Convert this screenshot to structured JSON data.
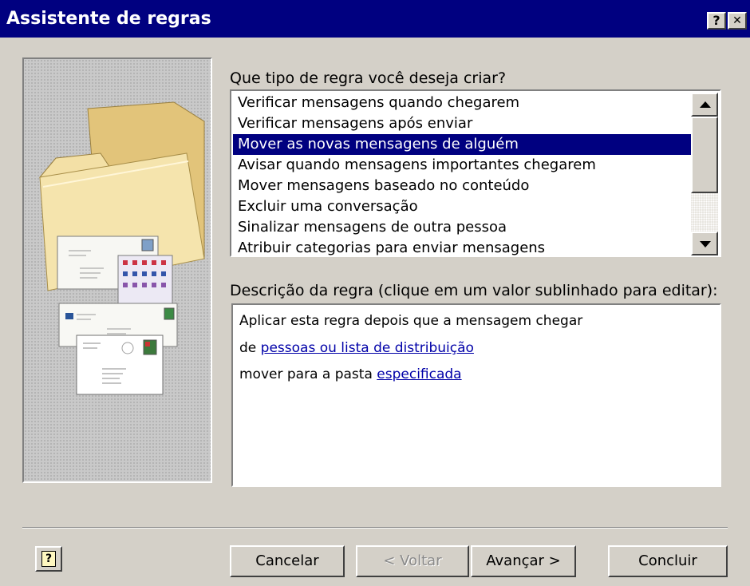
{
  "window": {
    "title": "Assistente de regras",
    "help_button": "?",
    "close_button": "✕"
  },
  "rule_type": {
    "label": "Que tipo de regra você deseja criar?",
    "items": [
      "Verificar mensagens quando chegarem",
      "Verificar mensagens após enviar",
      "Mover as novas mensagens de alguém",
      "Avisar quando mensagens importantes chegarem",
      "Mover mensagens baseado no conteúdo",
      "Excluir uma conversação",
      "Sinalizar mensagens de outra pessoa",
      "Atribuir categorias para enviar mensagens"
    ],
    "selected_index": 2
  },
  "description": {
    "label": "Descrição da regra (clique em um valor sublinhado para editar):",
    "line1": "Aplicar esta regra depois que a mensagem chegar",
    "line2_prefix": "de",
    "line2_link": "pessoas ou lista de distribuição",
    "line3_prefix": "mover para a pasta",
    "line3_link": "especificada"
  },
  "buttons": {
    "help": "?",
    "cancel": "Cancelar",
    "back": "< Voltar",
    "next": "Avançar >",
    "finish": "Concluir"
  },
  "colors": {
    "title_bar": "#000080",
    "selection": "#000080",
    "link": "#0000a8",
    "dialog_bg": "#d4d0c8"
  }
}
